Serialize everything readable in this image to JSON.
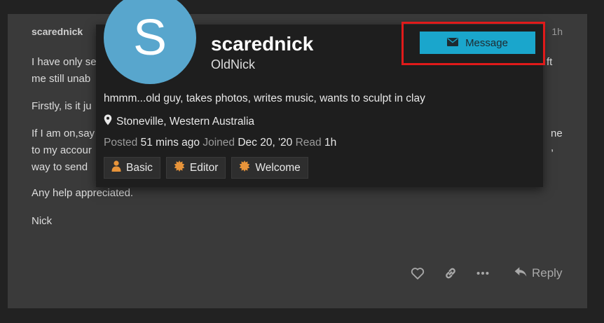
{
  "post": {
    "author": "scarednick",
    "time": "1h",
    "lines": [
      "I have only se",
      "me still unab",
      "Firstly, is it ju",
      "If I am on,say",
      "to my accour",
      "way to send",
      "Any help appreciated.",
      "Nick"
    ],
    "right_fragments": [
      "ft",
      "ne",
      ","
    ],
    "reply_label": "Reply"
  },
  "card": {
    "avatar_letter": "S",
    "username": "scarednick",
    "name": "OldNick",
    "message_label": "Message",
    "bio": "hmmm...old guy, takes photos, writes music, wants to sculpt in clay",
    "location": "Stoneville, Western Australia",
    "stats": {
      "posted_label": "Posted",
      "posted_value": "51 mins ago",
      "joined_label": "Joined",
      "joined_value": "Dec 20, '20",
      "read_label": "Read",
      "read_value": "1h"
    },
    "badges": [
      {
        "label": "Basic",
        "icon": "user-icon"
      },
      {
        "label": "Editor",
        "icon": "badge-sun-icon"
      },
      {
        "label": "Welcome",
        "icon": "badge-sun-icon"
      }
    ]
  },
  "colors": {
    "accent": "#1aa6cc",
    "avatar": "#58a6cd",
    "highlight": "#e01a1a",
    "badge_icon": "#e8943a"
  }
}
